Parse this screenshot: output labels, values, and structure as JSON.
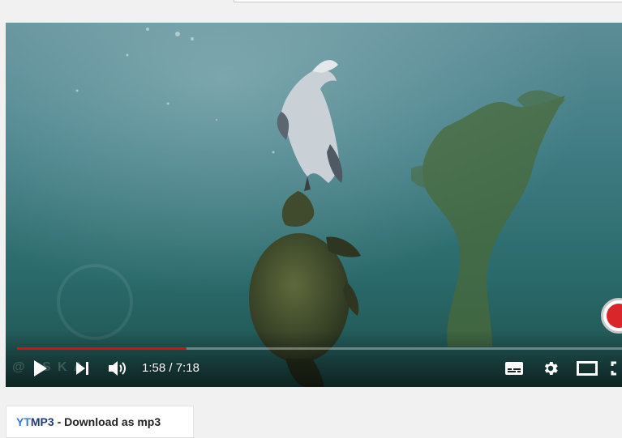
{
  "player": {
    "current_time": "1:58",
    "time_separator": " / ",
    "duration": "7:18",
    "progress_fraction": 0.28,
    "watermark": "@   S K   A",
    "colors": {
      "progress_played": "#e00d0d",
      "progress_track": "#ffffff",
      "water": "#2f6d74"
    }
  },
  "controls": {
    "left": [
      "play-icon",
      "next-icon",
      "volume-icon"
    ],
    "right": [
      "subtitles-icon",
      "gear-icon",
      "theater-mode-icon",
      "fullscreen-icon"
    ]
  },
  "extension": {
    "brand_yt": "YT",
    "brand_mp3": "MP3",
    "label": " - Download as mp3"
  }
}
